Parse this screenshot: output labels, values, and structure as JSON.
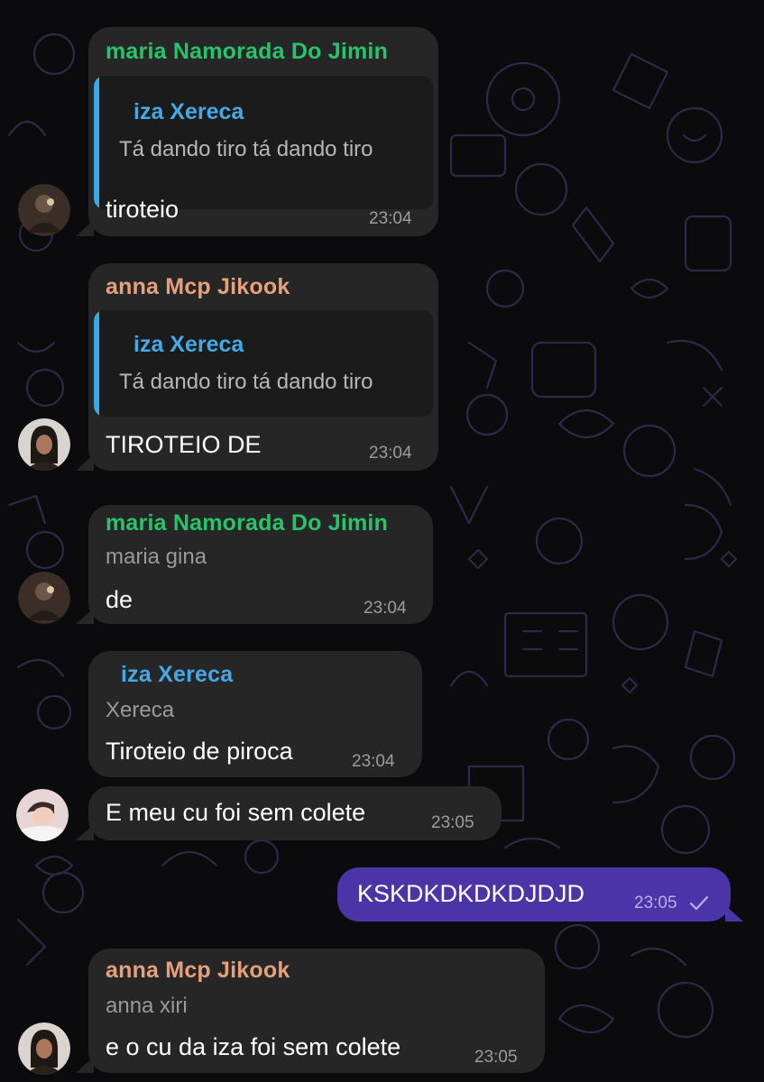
{
  "messages": [
    {
      "sender": "maria Namorada Do Jimin",
      "reply_to": {
        "name": "iza Xereca",
        "text": "Tá dando tiro tá dando tiro"
      },
      "text": "tiroteio",
      "time": "23:04",
      "avatar": "avatar-maria"
    },
    {
      "sender": "anna Mcp Jikook",
      "reply_to": {
        "name": "iza Xereca",
        "text": "Tá dando tiro tá dando tiro"
      },
      "text": "TIROTEIO DE",
      "time": "23:04",
      "avatar": "avatar-anna"
    },
    {
      "sender": "maria Namorada Do Jimin",
      "subtitle": "maria gina",
      "text": "de",
      "time": "23:04",
      "avatar": "avatar-maria"
    },
    {
      "sender": "iza Xereca",
      "subtitle": "Xereca",
      "text": "Tiroteio de piroca",
      "time": "23:04"
    },
    {
      "text": "E meu cu foi sem colete",
      "time": "23:05",
      "avatar": "avatar-iza"
    },
    {
      "outgoing": true,
      "text": "KSKDKDKDKDJDJD",
      "time": "23:05",
      "status": "sent-check-icon"
    },
    {
      "sender": "anna Mcp Jikook",
      "subtitle": "anna xiri",
      "text": "e o cu da iza foi sem colete",
      "time": "23:05",
      "avatar": "avatar-anna"
    }
  ],
  "colors": {
    "background": "#0b0b0d",
    "incoming_bubble": "#262626",
    "outgoing_bubble": "#4a34a8",
    "quote_bar": "#3ba9e8",
    "name_green": "#27c46b",
    "name_orange": "#e6a07c",
    "name_blue": "#46a9e6"
  }
}
